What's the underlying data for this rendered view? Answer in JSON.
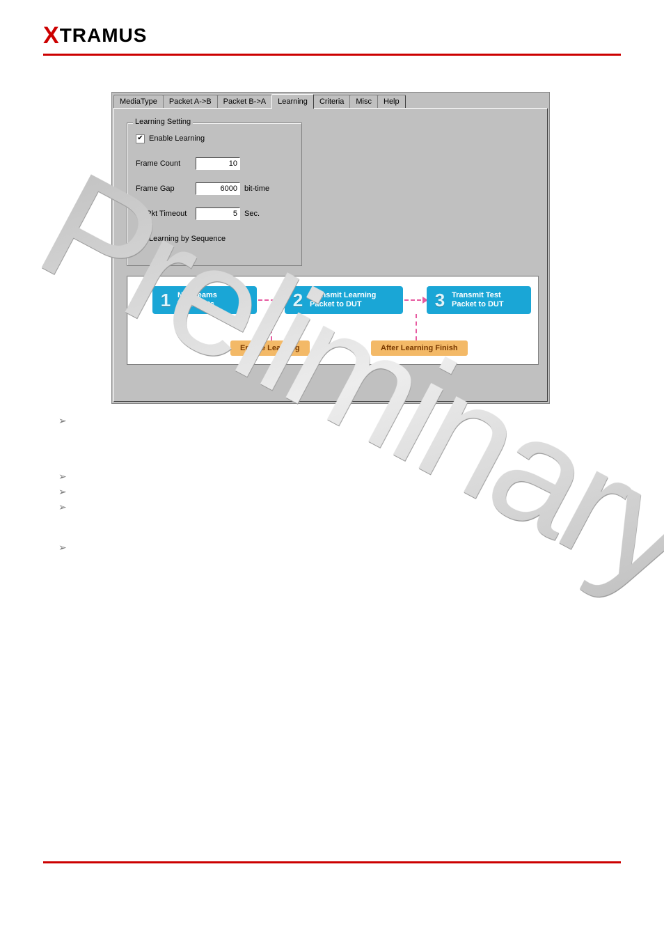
{
  "brand": {
    "prefix": "X",
    "rest": "TRAMUS"
  },
  "tabs": [
    "MediaType",
    "Packet A->B",
    "Packet B->A",
    "Learning",
    "Criteria",
    "Misc",
    "Help"
  ],
  "active_tab_index": 3,
  "group": {
    "legend": "Learning Setting",
    "enable_label": "Enable Learning",
    "enable_checked": true,
    "frame_count_label": "Frame Count",
    "frame_count_value": "10",
    "frame_gap_label": "Frame Gap",
    "frame_gap_value": "6000",
    "frame_gap_unit": "bit-time",
    "tx_timeout_label": "Tx Pkt Timeout",
    "tx_timeout_value": "5",
    "tx_timeout_unit": "Sec.",
    "seq_label": "Learning by Sequence",
    "seq_checked": false
  },
  "diagram": {
    "step1_num": "1",
    "step1_l1": "Nustreams",
    "step1_l2": "Test Ports",
    "step2_num": "2",
    "step2_l1": "Transmit Learning",
    "step2_l2": "Packet to DUT",
    "step3_num": "3",
    "step3_l1": "Transmit Test",
    "step3_l2": "Packet to DUT",
    "tag1": "Enable Learning",
    "tag2": "After Learning Finish"
  },
  "watermark": "Preliminary"
}
